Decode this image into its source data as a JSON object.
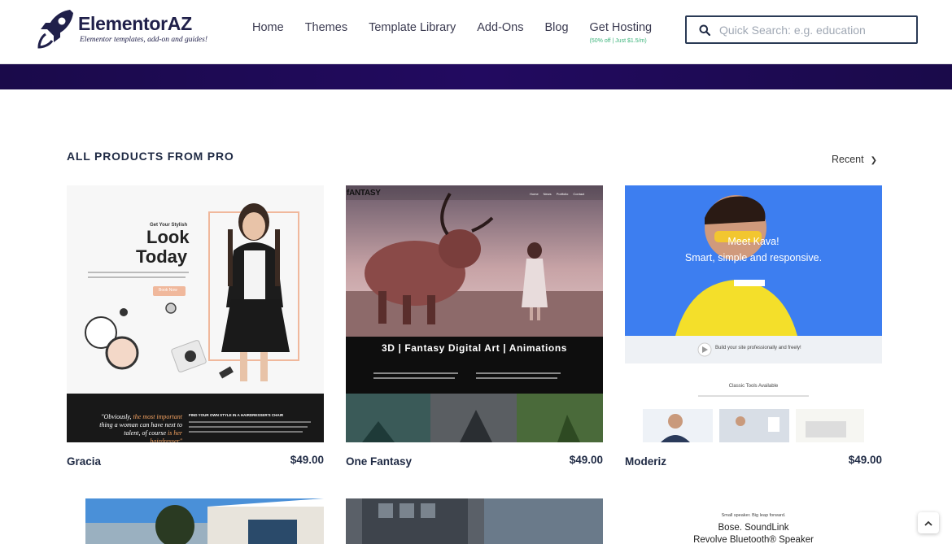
{
  "header": {
    "logo_title": "ElementorAZ",
    "logo_tagline": "Elementor templates, add-on and guides!",
    "nav": [
      {
        "label": "Home"
      },
      {
        "label": "Themes"
      },
      {
        "label": "Template Library"
      },
      {
        "label": "Add-Ons"
      },
      {
        "label": "Blog"
      },
      {
        "label": "Get Hosting",
        "sub": "(50% off | Just $1.5/m)"
      }
    ],
    "search_placeholder": "Quick Search: e.g. education"
  },
  "colors": {
    "band": "#1a0a4a",
    "heading": "#1f2a44",
    "accent_green": "#3bb37a"
  },
  "section": {
    "title": "ALL PRODUCTS FROM PRO",
    "sort_label": "Recent"
  },
  "products": [
    {
      "name": "Gracia",
      "price": "$49.00",
      "thumb": {
        "kicker": "Get Your Stylish",
        "headline_1": "Look",
        "headline_2": "Today",
        "button": "Book Now",
        "quote_pre": "\"Obviously, ",
        "quote_hl1": "the most important",
        "quote_mid": " thing a woman can have next to talent, of course ",
        "quote_hl2": "is her hairdresser\"",
        "find_title": "FIND YOUR OWN STYLE IN A HAIRDRESSER'S CHAIR"
      }
    },
    {
      "name": "One Fantasy",
      "price": "$49.00",
      "thumb": {
        "brand": "fANTASY",
        "menu": [
          "Home",
          "News",
          "Portfolio",
          "Contact"
        ],
        "banner": "3D | Fantasy Digital Art | Animations"
      }
    },
    {
      "name": "Moderiz",
      "price": "$49.00",
      "thumb": {
        "hero_1": "Meet Kava!",
        "hero_2": "Smart, simple and responsive.",
        "strip": "Build your site professionally and freely!",
        "tools_title": "Classic Tools Available"
      }
    }
  ],
  "row2": {
    "third": {
      "kicker": "Small speaker. Big leap forward.",
      "line1": "Bose. SoundLink",
      "line2": "Revolve Bluetooth® Speaker"
    }
  },
  "scroll_top_icon": "chevron-up-icon"
}
